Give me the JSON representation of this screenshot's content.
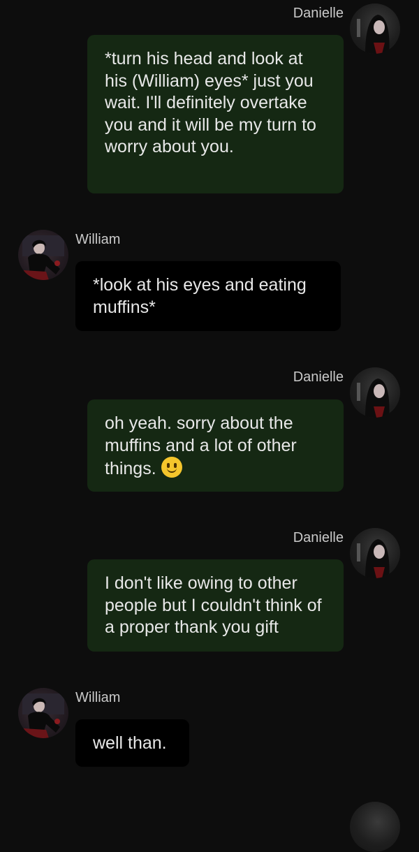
{
  "messages": [
    {
      "sender": "Danielle",
      "text": "*turn his head and look at his (William) eyes* just you wait. I'll definitely overtake you and it will be my turn to worry about you."
    },
    {
      "sender": "William",
      "text": "*look at his eyes and eating muffins*"
    },
    {
      "sender": "Danielle",
      "text": "oh yeah. sorry about the muffins and a lot of other things. ",
      "emoji": "slightly-smiling-face"
    },
    {
      "sender": "Danielle",
      "text": "I don't like owing to other people but I couldn't think of a proper thank you gift"
    },
    {
      "sender": "William",
      "text": "well than."
    }
  ],
  "colors": {
    "background": "#0d0d0d",
    "own_bubble": "#152813",
    "other_bubble": "#000000",
    "name_text": "#c9c9c9",
    "message_text": "#e8e8e8"
  }
}
